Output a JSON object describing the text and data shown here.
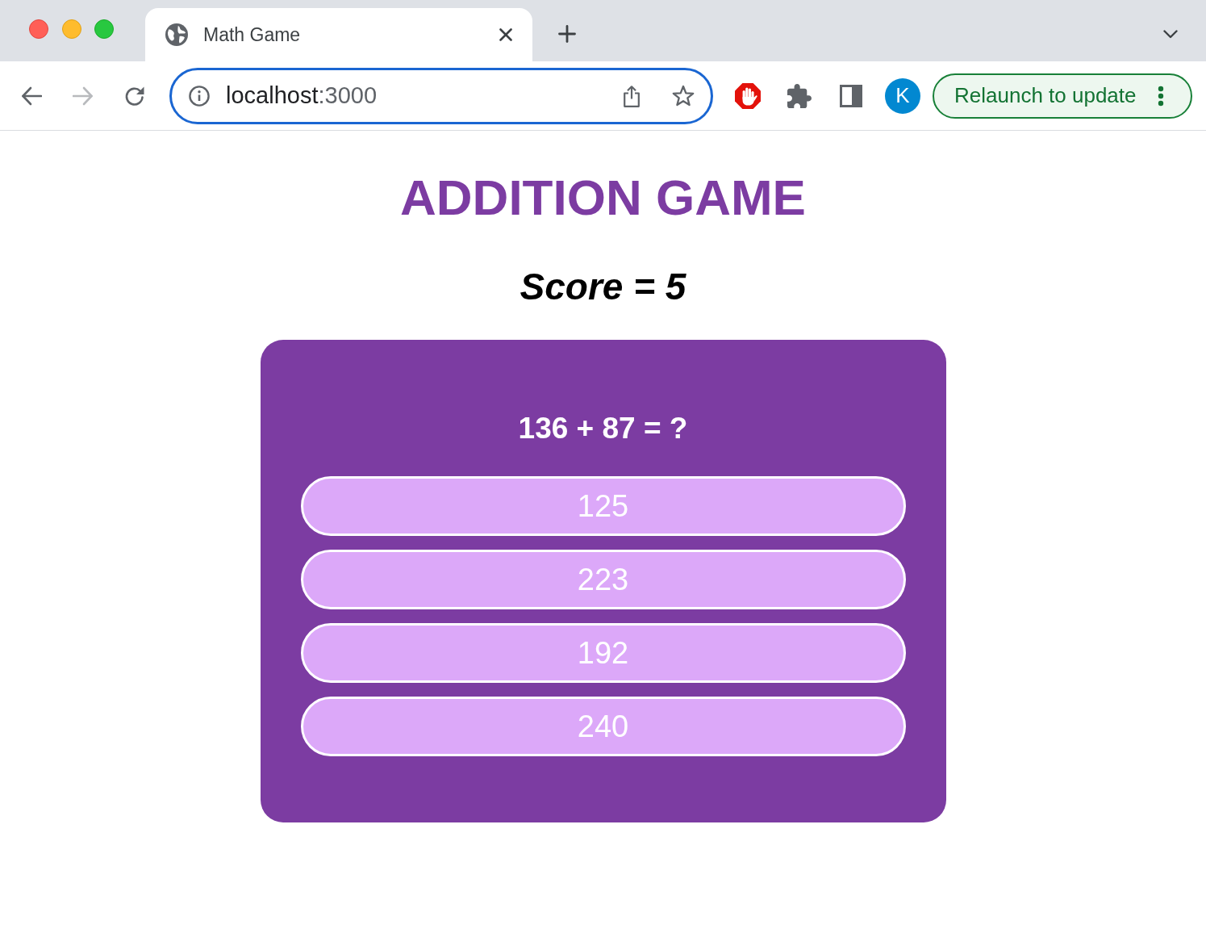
{
  "tabs": [
    {
      "title": "Math Game",
      "selected": true
    }
  ],
  "toolbar": {
    "nav_buttons": [
      {
        "kind": "back",
        "disabled": false
      },
      {
        "kind": "forward",
        "disabled": true
      },
      {
        "kind": "reload",
        "disabled": false
      }
    ],
    "address_bar": {
      "focused": true,
      "host": "localhost",
      "port": ":3000"
    },
    "profile": {
      "initial": "K"
    },
    "update_button": {
      "label": "Relaunch to update"
    }
  },
  "page": {
    "title": "ADDITION GAME",
    "score": "Score = 5",
    "question": "136 + 87 = ?",
    "answers": [
      "125",
      "223",
      "192",
      "240"
    ]
  }
}
